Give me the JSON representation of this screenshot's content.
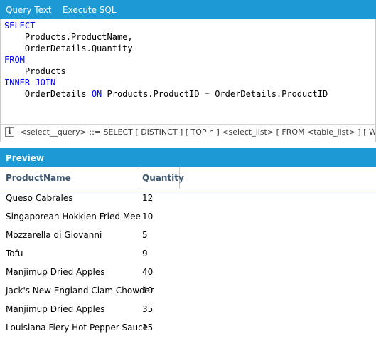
{
  "tabs": {
    "query_text": "Query Text",
    "execute_sql": "Execute SQL"
  },
  "sql": {
    "lines": [
      [
        {
          "t": "SELECT",
          "kw": true
        }
      ],
      [
        {
          "t": "    Products.ProductName,",
          "kw": false
        }
      ],
      [
        {
          "t": "    OrderDetails.Quantity",
          "kw": false
        }
      ],
      [
        {
          "t": "FROM",
          "kw": true
        }
      ],
      [
        {
          "t": "    Products",
          "kw": false
        }
      ],
      [
        {
          "t": "INNER JOIN",
          "kw": true
        }
      ],
      [
        {
          "t": "    OrderDetails ",
          "kw": false
        },
        {
          "t": "ON",
          "kw": true
        },
        {
          "t": " Products.ProductID = OrderDetails.ProductID",
          "kw": false
        }
      ]
    ]
  },
  "hint": {
    "icon": "info-icon",
    "text": "<select__query> ::= SELECT [ DISTINCT ] [ TOP n ] <select_list> [ FROM <table_list> ] [ WHERE <expression> ]"
  },
  "preview": {
    "title": "Preview",
    "columns": [
      "ProductName",
      "Quantity"
    ],
    "rows": [
      [
        "Queso Cabrales",
        "12"
      ],
      [
        "Singaporean Hokkien Fried Mee",
        "10"
      ],
      [
        "Mozzarella di Giovanni",
        "5"
      ],
      [
        "Tofu",
        "9"
      ],
      [
        "Manjimup Dried Apples",
        "40"
      ],
      [
        "Jack's New England Clam Chowder",
        "10"
      ],
      [
        "Manjimup Dried Apples",
        "35"
      ],
      [
        "Louisiana Fiery Hot Pepper Sauce",
        "15"
      ]
    ]
  },
  "colors": {
    "accent": "#1c9ad6",
    "keyword": "#0000ff",
    "header_text": "#3d5670"
  }
}
